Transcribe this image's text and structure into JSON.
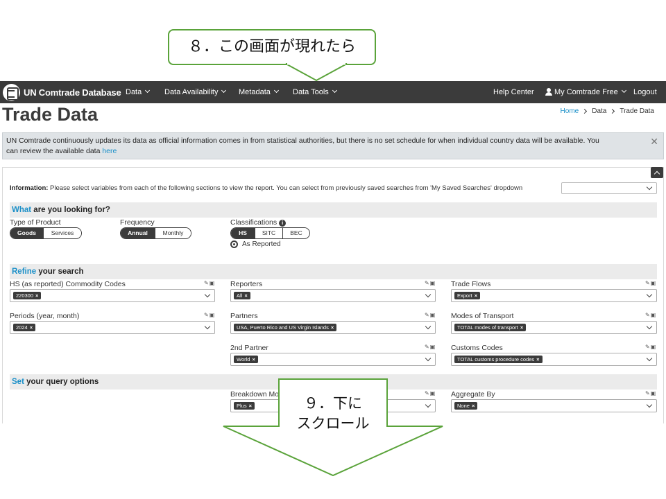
{
  "navbar": {
    "brand": "UN Comtrade Database",
    "items": [
      {
        "label": "Data"
      },
      {
        "label": "Data Availability"
      },
      {
        "label": "Metadata"
      },
      {
        "label": "Data Tools"
      }
    ],
    "help": "Help Center",
    "account": "My Comtrade Free",
    "logout": "Logout"
  },
  "page": {
    "title": "Trade Data",
    "breadcrumb": [
      "Home",
      "Data",
      "Trade Data"
    ]
  },
  "alert": {
    "text": "UN Comtrade continuously updates its data as official information comes in from statistical authorities, but there is no set schedule for when individual country data will be available. You can review the available data ",
    "link": "here",
    "close": "✕"
  },
  "info": {
    "label": "Information:",
    "text": " Please select variables from each of the following sections to view the report. You can select from previously saved searches from 'My Saved Searches' dropdown"
  },
  "sections": {
    "what": {
      "accent": "What",
      "rest": " are you looking for?"
    },
    "refine": {
      "accent": "Refine",
      "rest": " your search"
    },
    "set": {
      "accent": "Set",
      "rest": " your query options"
    }
  },
  "what": {
    "type_label": "Type of Product",
    "type_options": [
      "Goods",
      "Services"
    ],
    "type_selected": "Goods",
    "freq_label": "Frequency",
    "freq_options": [
      "Annual",
      "Monthly"
    ],
    "freq_selected": "Annual",
    "class_label": "Classifications",
    "class_options": [
      "HS",
      "SITC",
      "BEC"
    ],
    "class_selected": "HS",
    "as_reported": "As Reported"
  },
  "refine": {
    "commodity": {
      "label": "HS (as reported) Commodity Codes",
      "tag": "220300"
    },
    "reporters": {
      "label": "Reporters",
      "tag": "All"
    },
    "flows": {
      "label": "Trade Flows",
      "tag": "Export"
    },
    "periods": {
      "label": "Periods (year, month)",
      "tag": "2024"
    },
    "partners": {
      "label": "Partners",
      "tag": "USA, Puerto Rico and US Virgin Islands"
    },
    "transport": {
      "label": "Modes of Transport",
      "tag": "TOTAL modes of transport"
    },
    "partner2": {
      "label": "2nd Partner",
      "tag": "World"
    },
    "customs": {
      "label": "Customs Codes",
      "tag": "TOTAL customs procedure codes"
    }
  },
  "options": {
    "breakdown": {
      "label": "Breakdown Mod",
      "tag": "Plus"
    },
    "aggregate": {
      "label": "Aggregate By",
      "tag": "None"
    }
  },
  "callouts": {
    "step8": "８．この画面が現れたら",
    "step9_line1": "９．下に",
    "step9_line2": "スクロール",
    "color": "#5aa33a"
  },
  "colors": {
    "nav": "#3b3b3b",
    "accent": "#1a8fc8",
    "alert_bg": "#dfe3e6"
  }
}
